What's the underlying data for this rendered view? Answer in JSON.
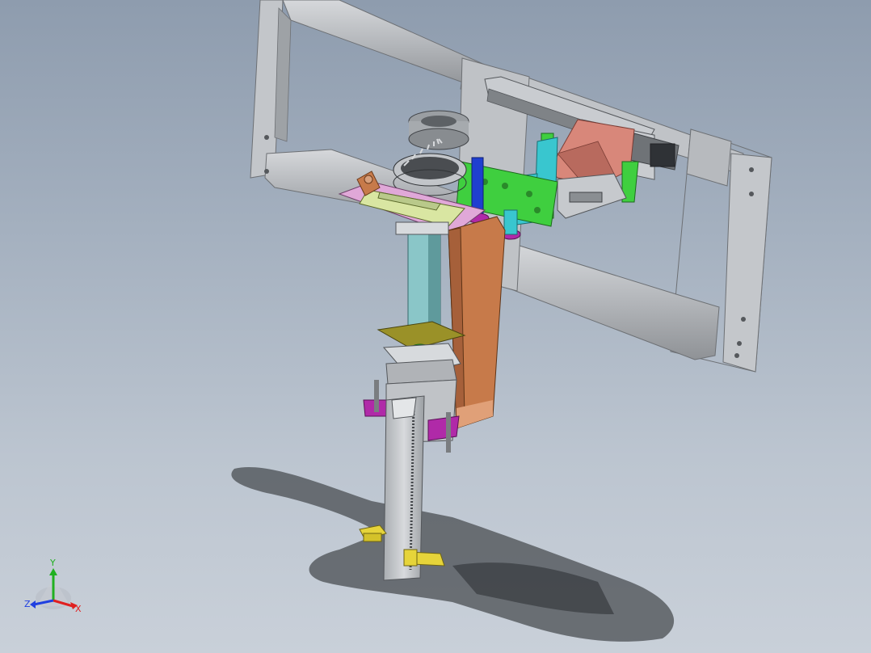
{
  "triad": {
    "x_label": "X",
    "y_label": "Y",
    "z_label": "Z",
    "x_color": "#e02020",
    "y_color": "#20b020",
    "z_color": "#2040e0"
  },
  "colors": {
    "frame": "#b9bcc0",
    "frame_dark": "#8b8e92",
    "green_plate": "#3fcf3f",
    "copper": "#c77a4a",
    "purple": "#b02aa8",
    "yellow": "#e6d43a",
    "cyan": "#39c6cf",
    "salmon": "#d8877a",
    "pink_plate": "#e0a8d8"
  }
}
